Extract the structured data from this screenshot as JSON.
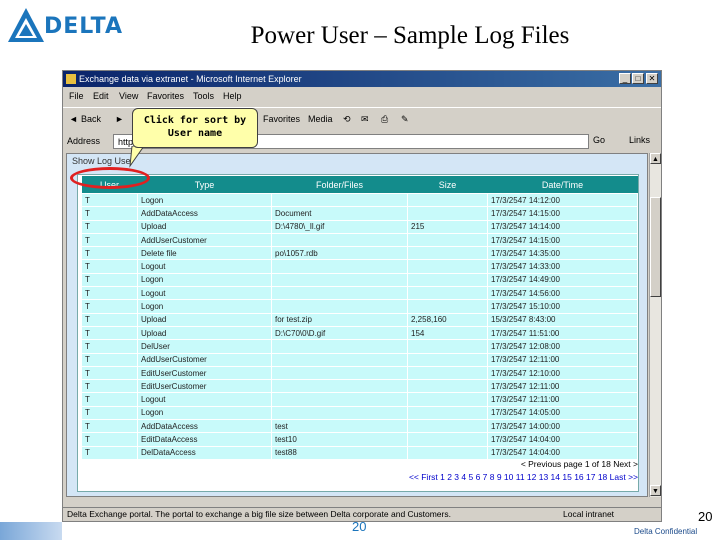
{
  "slide": {
    "title": "Power User – Sample Log Files",
    "logo_text": "DELTA",
    "footer_number": "20",
    "page_number": "20",
    "confidential": "Delta Confidential"
  },
  "window": {
    "title": "Exchange data via extranet - Microsoft Internet Explorer",
    "menu": [
      "File",
      "Edit",
      "View",
      "Favorites",
      "Tools",
      "Help"
    ],
    "toolbar": {
      "back": "Back",
      "favorites": "Favorites",
      "media": "Media"
    },
    "address_label": "Address",
    "address_value": "http://                                        extralog.asp",
    "go": "Go",
    "links": "Links",
    "frame_title": "Show Log User",
    "status_left": "Delta Exchange portal. The portal to exchange a big file size between Delta corporate and Customers.",
    "status_right": "Local intranet"
  },
  "callout": {
    "line1": "Click for sort by",
    "line2": "User name"
  },
  "log_table": {
    "headers": [
      "User",
      "Type",
      "Folder/Files",
      "Size",
      "Date/Time"
    ],
    "rows": [
      [
        "T",
        "Logon",
        "",
        "",
        "17/3/2547 14:12:00"
      ],
      [
        "T",
        "AddDataAccess",
        "Document",
        "",
        "17/3/2547 14:15:00"
      ],
      [
        "T",
        "Upload",
        "D:\\4780\\_Il.gif",
        "215",
        "17/3/2547 14:14:00"
      ],
      [
        "T",
        "AddUserCustomer",
        "",
        "",
        "17/3/2547 14:15:00"
      ],
      [
        "T",
        "Delete file",
        "po\\1057.rdb",
        "",
        "17/3/2547 14:35:00"
      ],
      [
        "T",
        "Logout",
        "",
        "",
        "17/3/2547 14:33:00"
      ],
      [
        "T",
        "Logon",
        "",
        "",
        "17/3/2547 14:49:00"
      ],
      [
        "T",
        "Logout",
        "",
        "",
        "17/3/2547 14:56:00"
      ],
      [
        "T",
        "Logon",
        "",
        "",
        "17/3/2547 15:10:00"
      ],
      [
        "T",
        "Upload",
        "for test.zip",
        "2,258,160",
        "15/3/2547 8:43:00"
      ],
      [
        "T",
        "Upload",
        "D:\\C70\\0\\D.gif",
        "154",
        "17/3/2547 11:51:00"
      ],
      [
        "T",
        "DelUser",
        "",
        "",
        "17/3/2547 12:08:00"
      ],
      [
        "T",
        "AddUserCustomer",
        "",
        "",
        "17/3/2547 12:11:00"
      ],
      [
        "T",
        "EditUserCustomer",
        "",
        "",
        "17/3/2547 12:10:00"
      ],
      [
        "T",
        "EditUserCustomer",
        "",
        "",
        "17/3/2547 12:11:00"
      ],
      [
        "T",
        "Logout",
        "",
        "",
        "17/3/2547 12:11:00"
      ],
      [
        "T",
        "Logon",
        "",
        "",
        "17/3/2547 14:05:00"
      ],
      [
        "T",
        "AddDataAccess",
        "test",
        "",
        "17/3/2547 14:00:00"
      ],
      [
        "T",
        "EditDataAccess",
        "test10",
        "",
        "17/3/2547 14:04:00"
      ],
      [
        "T",
        "DelDataAccess",
        "test88",
        "",
        "17/3/2547 14:04:00"
      ]
    ]
  },
  "pager": {
    "nav": "< Previous page 1 of 18 Next >",
    "pages": "<< First 1 2 3 4 5 6 7 8 9 10 11 12 13 14 15 16 17 18 Last >>"
  }
}
